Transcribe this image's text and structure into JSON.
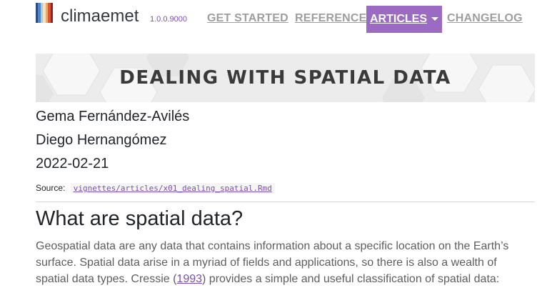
{
  "navbar": {
    "brand": "climaemet",
    "version": "1.0.0.9000",
    "links": [
      "GET STARTED",
      "REFERENCE",
      "ARTICLES",
      "CHANGELOG"
    ],
    "active": "ARTICLES",
    "active_color": "#9b6bc3"
  },
  "banner": {
    "title": "DEALING WITH SPATIAL DATA"
  },
  "meta": {
    "authors": [
      "Gema Fernández-Avilés",
      "Diego Hernangómez"
    ],
    "date": "2022-02-21",
    "source_label": "Source:",
    "source_path": "vignettes/articles/x01_dealing_spatial.Rmd"
  },
  "section": {
    "heading": "What are spatial data?",
    "para_part1": "Geospatial data are any data that contains information about a specific location on the Earth’s surface. Spatial data arise in a myriad of fields and applications, so there is also a wealth of spatial data types. Cressie (",
    "para_link": "1993",
    "para_part2": ") provides a simple and useful classification of spatial data:"
  }
}
